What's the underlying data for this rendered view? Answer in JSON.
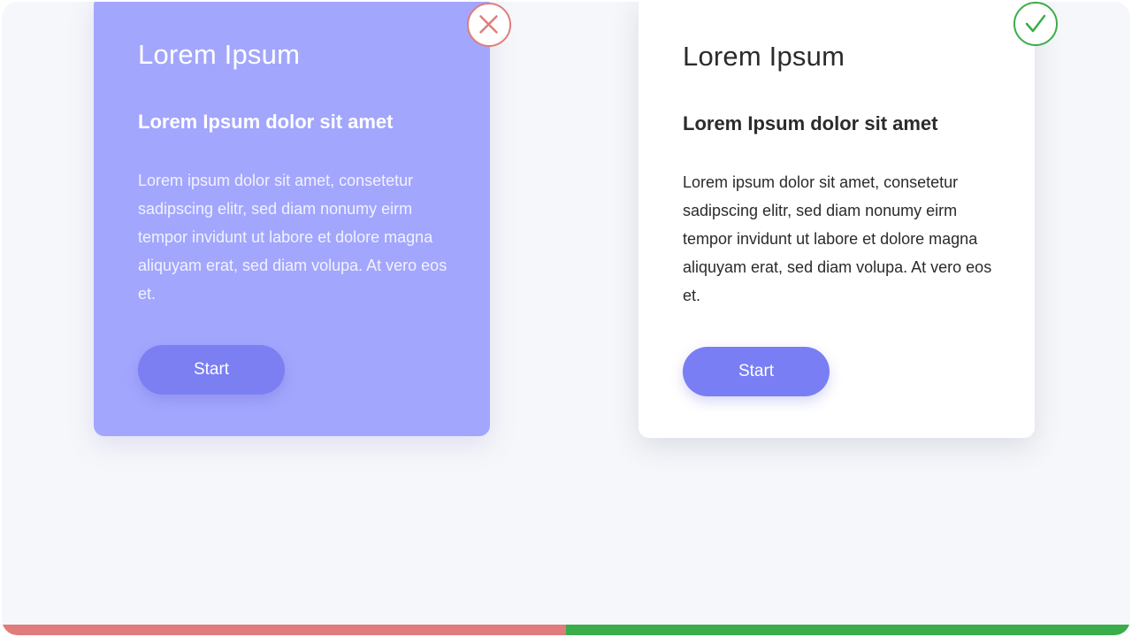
{
  "cards": {
    "bad": {
      "title": "Lorem Ipsum",
      "subtitle": "Lorem Ipsum dolor sit amet",
      "body": "Lorem ipsum dolor sit amet, consetetur sadipscing elitr, sed diam nonumy eirm tempor invidunt ut labore et dolore magna aliquyam erat, sed diam volupa. At vero eos et.",
      "button_label": "Start",
      "background_color": "#a3a6fd",
      "button_color": "#7b7ff2",
      "indicator_icon": "x-circle-icon",
      "indicator_color": "#e07c7c"
    },
    "good": {
      "title": "Lorem Ipsum",
      "subtitle": "Lorem Ipsum dolor sit amet",
      "body": "Lorem ipsum dolor sit amet, consetetur sadipscing elitr, sed diam nonumy eirm tempor invidunt ut labore et dolore magna aliquyam erat, sed diam volupa. At vero eos et.",
      "button_label": "Start",
      "background_color": "#ffffff",
      "button_color": "#797ef4",
      "indicator_icon": "check-circle-icon",
      "indicator_color": "#3aad4a"
    }
  },
  "bottom_bar": {
    "left_color": "#e07c7c",
    "right_color": "#3aad4a"
  }
}
